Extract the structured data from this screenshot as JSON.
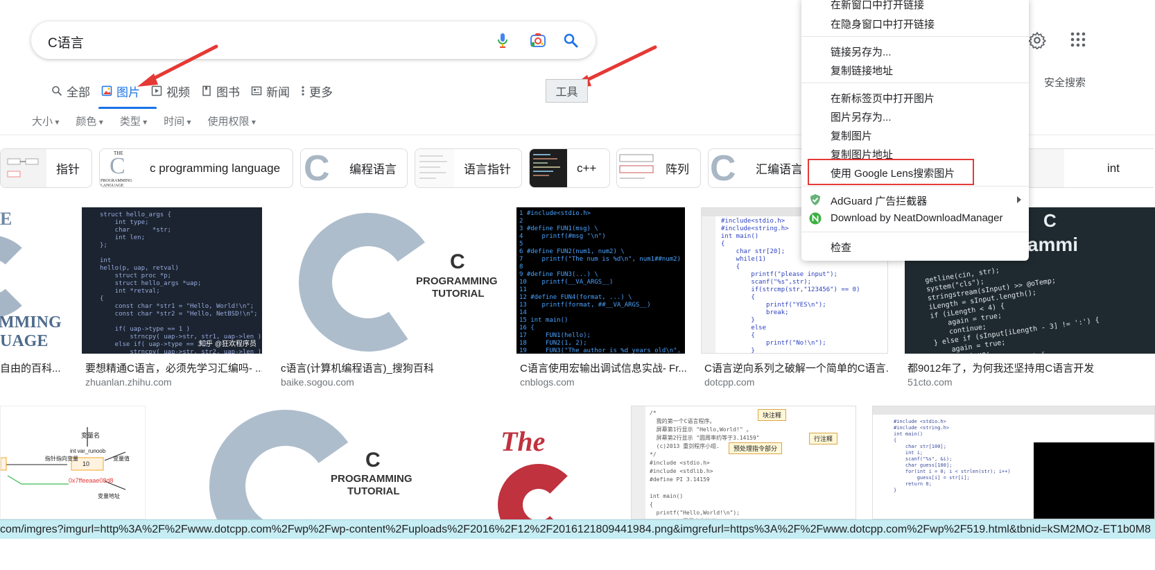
{
  "search": {
    "query": "C语言"
  },
  "tabs": [
    {
      "label": "全部",
      "icon": "search-icon"
    },
    {
      "label": "图片",
      "icon": "image-icon"
    },
    {
      "label": "视频",
      "icon": "video-icon"
    },
    {
      "label": "图书",
      "icon": "book-icon"
    },
    {
      "label": "新闻",
      "icon": "news-icon"
    },
    {
      "label": "更多",
      "icon": "more-dots-icon"
    }
  ],
  "tools_label": "工具",
  "filters": [
    "大小",
    "颜色",
    "类型",
    "时间",
    "使用权限"
  ],
  "header_right": {
    "safesearch_label": "安全搜索"
  },
  "chips": [
    "指针",
    "c programming language",
    "编程语言",
    "语言指针",
    "c++",
    "阵列",
    "汇编语言",
    "int"
  ],
  "results_row1": [
    {
      "caption": "自由的百科...",
      "source": ""
    },
    {
      "caption": "要想精通C语言，必须先学习汇编吗- ...",
      "source": "zhuanlan.zhihu.com"
    },
    {
      "caption": "c语言(计算机编程语言)_搜狗百科",
      "source": "baike.sogou.com"
    },
    {
      "caption": "C语言使用宏输出调试信息实战- Fr...",
      "source": "cnblogs.com"
    },
    {
      "caption": "C语言逆向系列之破解一个简单的C语言...",
      "source": "dotcpp.com"
    },
    {
      "caption": "都9012年了，为何我还坚持用C语言开发",
      "source": "51cto.com"
    }
  ],
  "image_text": {
    "ct_title": "C",
    "ct_line1": "PROGRAMMING",
    "ct_line2": "TUTORIAL",
    "zhihu_watermark": "知乎 @狂欢程序员",
    "left_big_line1": "E",
    "left_big_line2": "MMING",
    "left_big_line3": "UAGE",
    "the": "The",
    "big_c": "C",
    "row2_label_var": "变量名",
    "row2_label_ptr": "指针指向变量",
    "row2_label_val": "变量值",
    "row2_label_addr": "变量地址",
    "row2_intvar": "int var_runoob",
    "row2_ten": "10",
    "row2_addr": "0x7ffeeaae08d8",
    "chip_the": "THE",
    "chip_lang": "PROGRAMMING LANGUAGE",
    "code_comment": "块注释",
    "code_comment2": "行注释",
    "code_pre": "预处理指令部分",
    "c_prog": "C",
    "c_prog_word": "rammi"
  },
  "context_menu": {
    "items_group1": [
      "在新窗口中打开链接",
      "在隐身窗口中打开链接"
    ],
    "items_group2": [
      "链接另存为...",
      "复制链接地址"
    ],
    "items_group3": [
      "在新标签页中打开图片",
      "图片另存为...",
      "复制图片",
      "复制图片地址",
      "使用 Google Lens搜索图片"
    ],
    "items_group4": [
      "AdGuard 广告拦截器",
      "Download by NeatDownloadManager"
    ],
    "items_group5": [
      "检查"
    ]
  },
  "status_url": "com/imgres?imgurl=http%3A%2F%2Fwww.dotcpp.com%2Fwp%2Fwp-content%2Fuploads%2F2016%2F12%2F2016121809441984.png&imgrefurl=https%3A%2F%2Fwww.dotcpp.com%2Fwp%2F519.html&tbnid=kSM2MOz-ET1b0M8",
  "colors": {
    "accent": "#1a73e8",
    "annotation_red": "#e53935",
    "status_bg": "#c6edf3"
  }
}
